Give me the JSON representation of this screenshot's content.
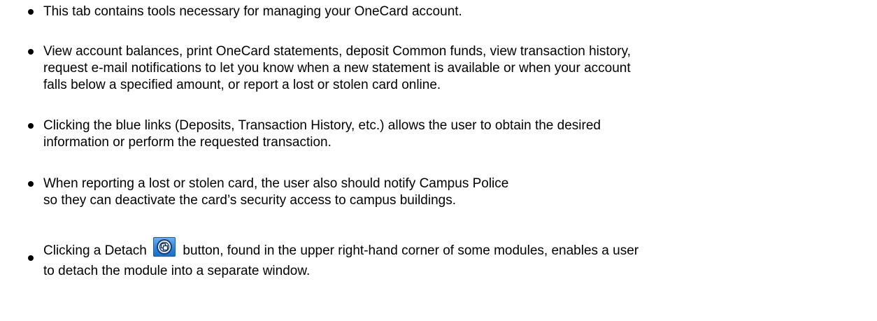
{
  "bullets": [
    {
      "lines": [
        "This tab contains tools necessary for managing your OneCard account."
      ]
    },
    {
      "lines": [
        "View account balances, print OneCard statements, deposit Common funds, view transaction history,",
        "request e-mail notifications to let you know when a new statement is available or when your account",
        "falls below a specified amount, or report a lost or stolen card online."
      ]
    },
    {
      "lines": [
        "Clicking the blue links (Deposits, Transaction History, etc.) allows the user to obtain the desired",
        "information or perform the requested transaction."
      ]
    },
    {
      "lines": [
        "When reporting a lost or stolen card, the user also should notify Campus Police",
        "so they can deactivate the card’s security access to campus buildings."
      ]
    },
    {
      "before_icon": "Clicking a Detach",
      "icon": "detach-icon",
      "after_icon": "button, found in the upper right-hand corner of some modules, enables a user",
      "line2": "to detach the module into a separate window."
    }
  ],
  "colors": {
    "text": "#000000",
    "icon_blue": "#2f86dc"
  }
}
